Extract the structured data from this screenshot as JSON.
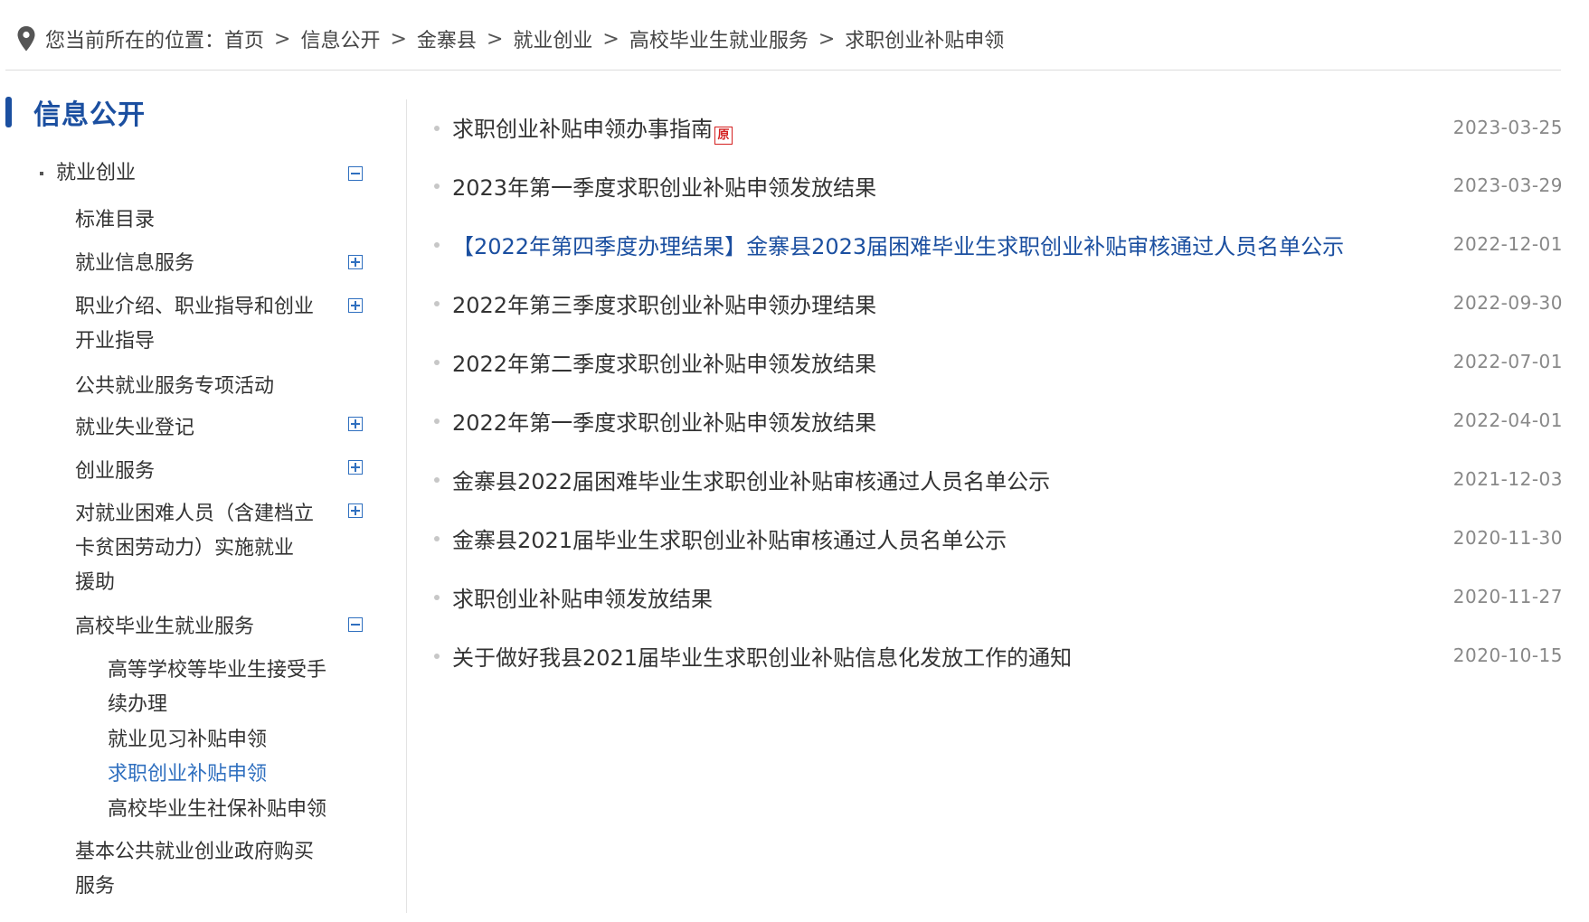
{
  "breadcrumb": {
    "prefix": "您当前所在的位置：",
    "items": [
      "首页",
      "信息公开",
      "金寨县",
      "就业创业",
      "高校毕业生就业服务",
      "求职创业补贴申领"
    ],
    "separator": ">"
  },
  "sidebar": {
    "title": "信息公开",
    "level1": {
      "label": "就业创业",
      "state": "expanded"
    },
    "items": [
      {
        "label": "标准目录"
      },
      {
        "label": "就业信息服务"
      },
      {
        "label_line1": "职业介绍、职业指导和创业",
        "label_line2": "开业指导"
      },
      {
        "label": "公共就业服务专项活动"
      },
      {
        "label": "就业失业登记"
      },
      {
        "label": "创业服务"
      },
      {
        "label_line1": "对就业困难人员（含建档立",
        "label_line2": "卡贫困劳动力）实施就业",
        "label_line3": "援助"
      },
      {
        "label": "高校毕业生就业服务"
      },
      {
        "label_line1": "基本公共就业创业政府购买",
        "label_line2": "服务"
      }
    ],
    "subitems": [
      {
        "label_line1": "高等学校等毕业生接受手",
        "label_line2": "续办理"
      },
      {
        "label": "就业见习补贴申领"
      },
      {
        "label": "求职创业补贴申领",
        "active": true
      },
      {
        "label": "高校毕业生社保补贴申领"
      }
    ]
  },
  "list": [
    {
      "title": "求职创业补贴申领办事指南",
      "date": "2023-03-25",
      "tag": "原"
    },
    {
      "title": "2023年第一季度求职创业补贴申领发放结果",
      "date": "2023-03-29"
    },
    {
      "title": "【2022年第四季度办理结果】金寨县2023届困难毕业生求职创业补贴审核通过人员名单公示",
      "date": "2022-12-01",
      "highlight": true
    },
    {
      "title": "2022年第三季度求职创业补贴申领办理结果",
      "date": "2022-09-30"
    },
    {
      "title": "2022年第二季度求职创业补贴申领发放结果",
      "date": "2022-07-01"
    },
    {
      "title": "2022年第一季度求职创业补贴申领发放结果",
      "date": "2022-04-01"
    },
    {
      "title": "金寨县2022届困难毕业生求职创业补贴审核通过人员名单公示",
      "date": "2021-12-03"
    },
    {
      "title": "金寨县2021届毕业生求职创业补贴审核通过人员名单公示",
      "date": "2020-11-30"
    },
    {
      "title": "求职创业补贴申领发放结果",
      "date": "2020-11-27"
    },
    {
      "title": "关于做好我县2021届毕业生求职创业补贴信息化发放工作的通知",
      "date": "2020-10-15"
    }
  ],
  "colors": {
    "accent": "#1b4fa0",
    "active_link": "#2f6fbf",
    "tag_red": "#d42020",
    "date_gray": "#888888"
  }
}
